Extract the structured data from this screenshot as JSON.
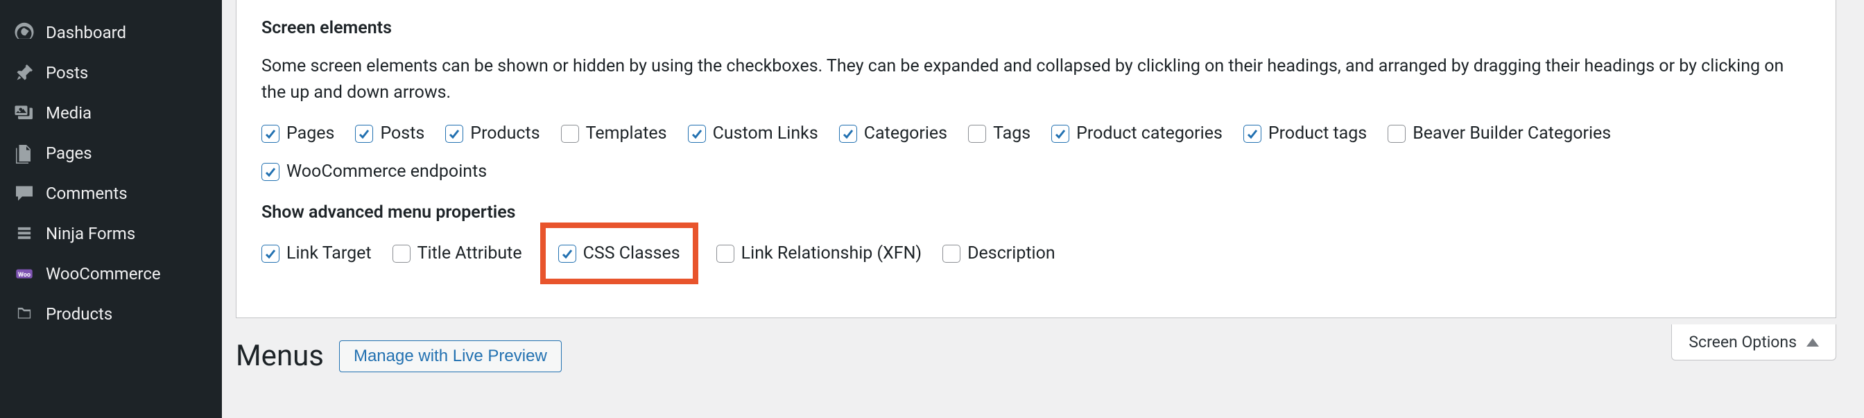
{
  "sidebar": {
    "items": [
      {
        "label": "Dashboard"
      },
      {
        "label": "Posts"
      },
      {
        "label": "Media"
      },
      {
        "label": "Pages"
      },
      {
        "label": "Comments"
      },
      {
        "label": "Ninja Forms"
      },
      {
        "label": "WooCommerce"
      },
      {
        "label": "Products"
      }
    ]
  },
  "panel": {
    "section1_title": "Screen elements",
    "section1_desc": "Some screen elements can be shown or hidden by using the checkboxes. They can be expanded and collapsed by clickling on their headings, and arranged by dragging their headings or by clicking on the up and down arrows.",
    "screen_elements": [
      {
        "label": "Pages",
        "checked": true
      },
      {
        "label": "Posts",
        "checked": true
      },
      {
        "label": "Products",
        "checked": true
      },
      {
        "label": "Templates",
        "checked": false
      },
      {
        "label": "Custom Links",
        "checked": true
      },
      {
        "label": "Categories",
        "checked": true
      },
      {
        "label": "Tags",
        "checked": false
      },
      {
        "label": "Product categories",
        "checked": true
      },
      {
        "label": "Product tags",
        "checked": true
      },
      {
        "label": "Beaver Builder Categories",
        "checked": false
      },
      {
        "label": "WooCommerce endpoints",
        "checked": true
      }
    ],
    "section2_title": "Show advanced menu properties",
    "advanced_props": [
      {
        "label": "Link Target",
        "checked": true
      },
      {
        "label": "Title Attribute",
        "checked": false
      },
      {
        "label": "CSS Classes",
        "checked": true,
        "highlight": true
      },
      {
        "label": "Link Relationship (XFN)",
        "checked": false
      },
      {
        "label": "Description",
        "checked": false
      }
    ]
  },
  "page": {
    "title": "Menus",
    "live_preview_btn": "Manage with Live Preview"
  },
  "screen_options_tab": "Screen Options"
}
